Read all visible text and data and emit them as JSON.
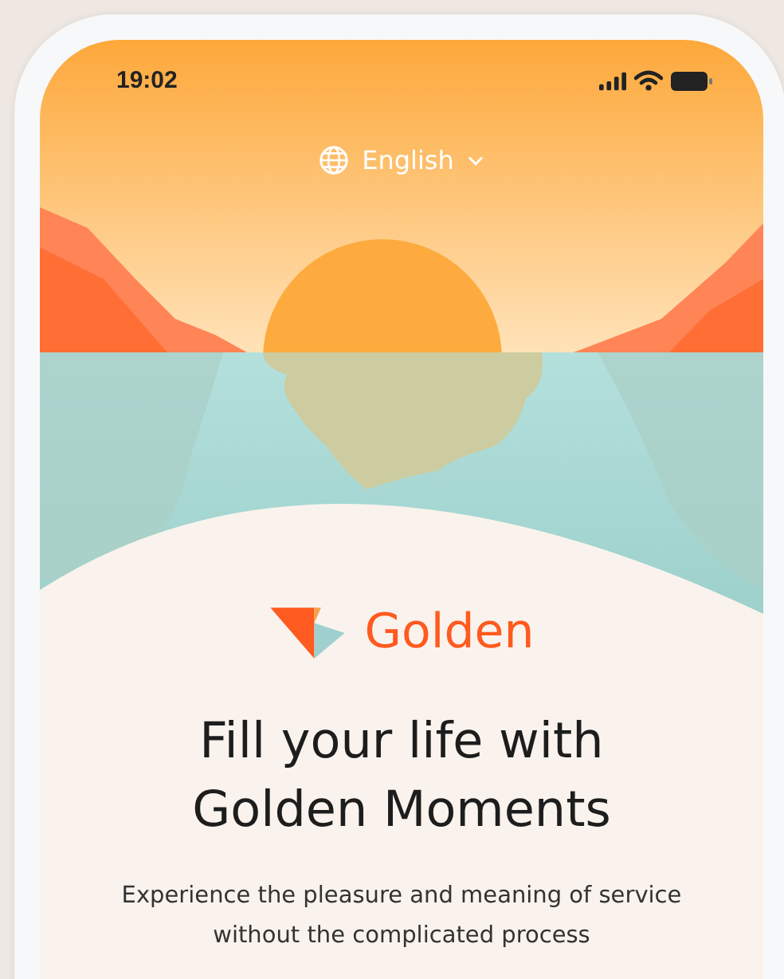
{
  "status_bar": {
    "time": "19:02"
  },
  "language_selector": {
    "label": "English"
  },
  "brand": {
    "name": "Golden"
  },
  "headline": "Fill your life with Golden Moments",
  "description": "Experience the pleasure and meaning of service without the complicated process"
}
